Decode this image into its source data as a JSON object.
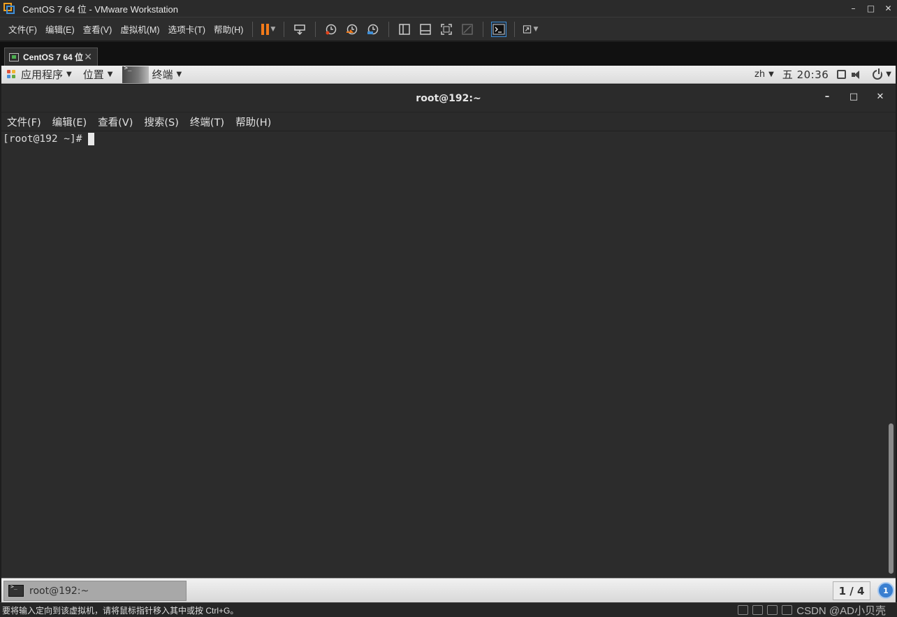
{
  "window": {
    "title": "CentOS 7 64 位 - VMware Workstation",
    "controls": [
      "–",
      "□",
      "✕"
    ]
  },
  "toolbar": {
    "menus": [
      "文件(F)",
      "编辑(E)",
      "查看(V)",
      "虚拟机(M)",
      "选项卡(T)",
      "帮助(H)"
    ],
    "icons": [
      "pause-icon",
      "send-ctrl-alt-del-icon",
      "snapshot-icon",
      "revert-snapshot-icon",
      "manage-snapshots-icon",
      "show-library-icon",
      "show-thumbnails-icon",
      "full-screen-icon",
      "unity-icon",
      "console-view-icon",
      "stretch-guest-icon"
    ],
    "accent": "#f27a1a"
  },
  "tab": {
    "label": "CentOS 7 64 位",
    "close": "✕"
  },
  "gnome_panel": {
    "applications": "应用程序",
    "places": "位置",
    "terminal": "终端",
    "input_method": "zh",
    "clock": "五 20:36"
  },
  "terminal": {
    "title": "root@192:~",
    "controls": [
      "–",
      "□",
      "✕"
    ],
    "menus": [
      "文件(F)",
      "编辑(E)",
      "查看(V)",
      "搜索(S)",
      "终端(T)",
      "帮助(H)"
    ],
    "prompt": "[root@192 ~]#"
  },
  "window_list": {
    "item": "root@192:~",
    "workspace": "1 / 4",
    "notifications": "1"
  },
  "status_bar": {
    "message": "要将输入定向到该虚拟机，请将鼠标指针移入其中或按 Ctrl+G。",
    "watermark": "CSDN @AD小贝壳"
  }
}
